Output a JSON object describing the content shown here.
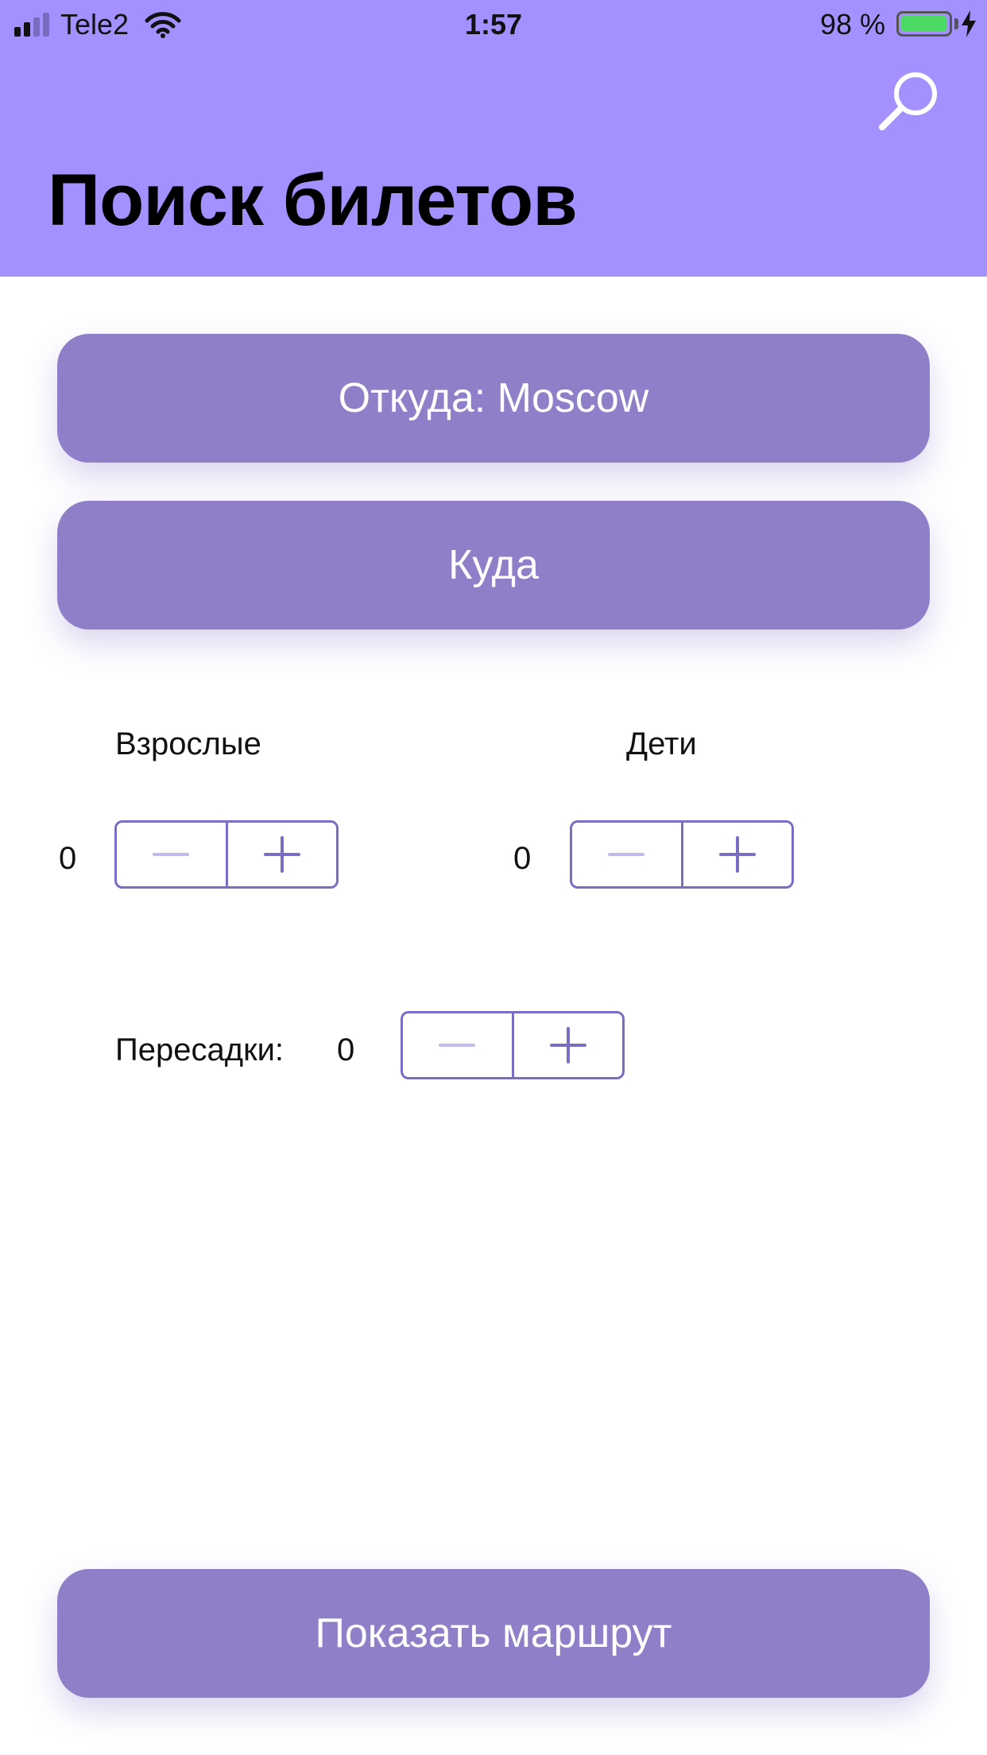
{
  "status_bar": {
    "carrier": "Tele2",
    "time": "1:57",
    "battery_percent": "98 %",
    "battery_level": 0.98,
    "signal_bars": 4,
    "signal_bars_active": 2
  },
  "header": {
    "title": "Поиск билетов",
    "background_color": "#a590ff",
    "search_icon": "search-icon"
  },
  "form": {
    "from_button": "Откуда: Moscow",
    "to_button": "Куда",
    "adults": {
      "label": "Взрослые",
      "value": "0"
    },
    "children": {
      "label": "Дети",
      "value": "0"
    },
    "transfers": {
      "label": "Пересадки:",
      "value": "0"
    },
    "stepper_icons": {
      "minus": "minus-icon",
      "plus": "plus-icon"
    }
  },
  "actions": {
    "show_route": "Показать маршрут"
  },
  "colors": {
    "accent": "#8f7fc8",
    "stepper": "#7b6cc4",
    "battery_fill": "#4cd964"
  }
}
